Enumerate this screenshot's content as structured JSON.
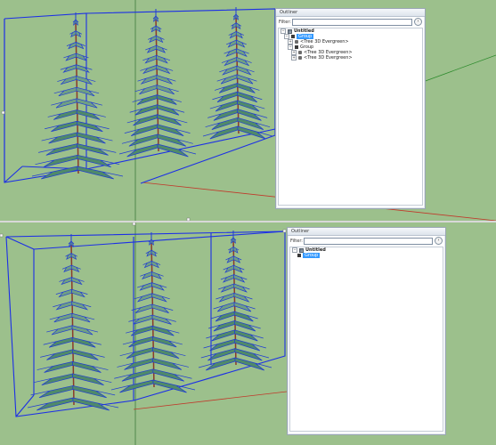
{
  "top": {
    "outliner": {
      "title": "Outliner",
      "filter_label": "Filter:",
      "filter_value": "",
      "menu_icon": "details-arrow-icon",
      "model_name": "Untitled",
      "items": [
        {
          "label": "Group",
          "selected": true
        },
        {
          "label": "<Tree 3D Evergreen>"
        },
        {
          "label": "Group"
        },
        {
          "label": "<Tree 3D Evergreen>"
        },
        {
          "label": "<Tree 3D Evergreen>"
        }
      ]
    }
  },
  "bottom": {
    "outliner": {
      "title": "Outliner",
      "filter_label": "Filter:",
      "filter_value": "",
      "menu_icon": "details-arrow-icon",
      "model_name": "Untitled",
      "items": [
        {
          "label": "Group",
          "selected": true
        }
      ]
    }
  },
  "colors": {
    "viewport_bg": "#9cc08c",
    "bounding_box": "#1c2fe6",
    "foliage": "#1f3bd4",
    "selection": "#3399ff"
  }
}
